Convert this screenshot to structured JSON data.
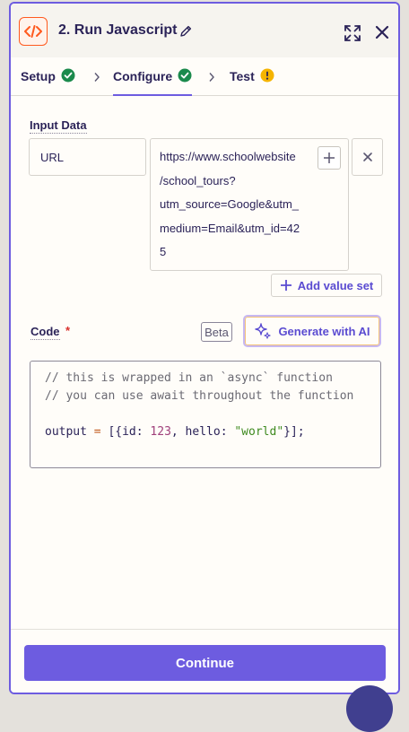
{
  "header": {
    "title": "2. Run Javascript",
    "app_icon": "code-icon",
    "accent": "#ff5a1f"
  },
  "tabs": [
    {
      "label": "Setup",
      "status": "check-circle-icon"
    },
    {
      "label": "Configure",
      "status": "check-circle-icon",
      "active": true
    },
    {
      "label": "Test",
      "status": "warning-icon"
    }
  ],
  "input_data": {
    "label": "Input Data",
    "key": "URL",
    "value_lines": [
      "https://www.schoolwebsite",
      "/school_tours?",
      "utm_source=Google&utm_",
      "medium=Email&utm_id=42",
      "5"
    ],
    "add_value_label": "Add value set"
  },
  "code": {
    "label": "Code",
    "required_mark": "*",
    "beta_label": "Beta",
    "generate_label": "Generate with AI",
    "comment1": "// this is wrapped in an `async` function",
    "comment2": "// you can use await throughout the function",
    "line3": {
      "var": "output ",
      "eq": "=",
      "open": " [{",
      "key1": "id: ",
      "num": "123",
      "sep": ", hello: ",
      "str": "\"world\"",
      "close": "}];"
    }
  },
  "footer": {
    "continue_label": "Continue"
  },
  "colors": {
    "primary": "#6d5ce0",
    "success": "#1b8a4c",
    "warning": "#f5b400",
    "text": "#2b2358"
  }
}
